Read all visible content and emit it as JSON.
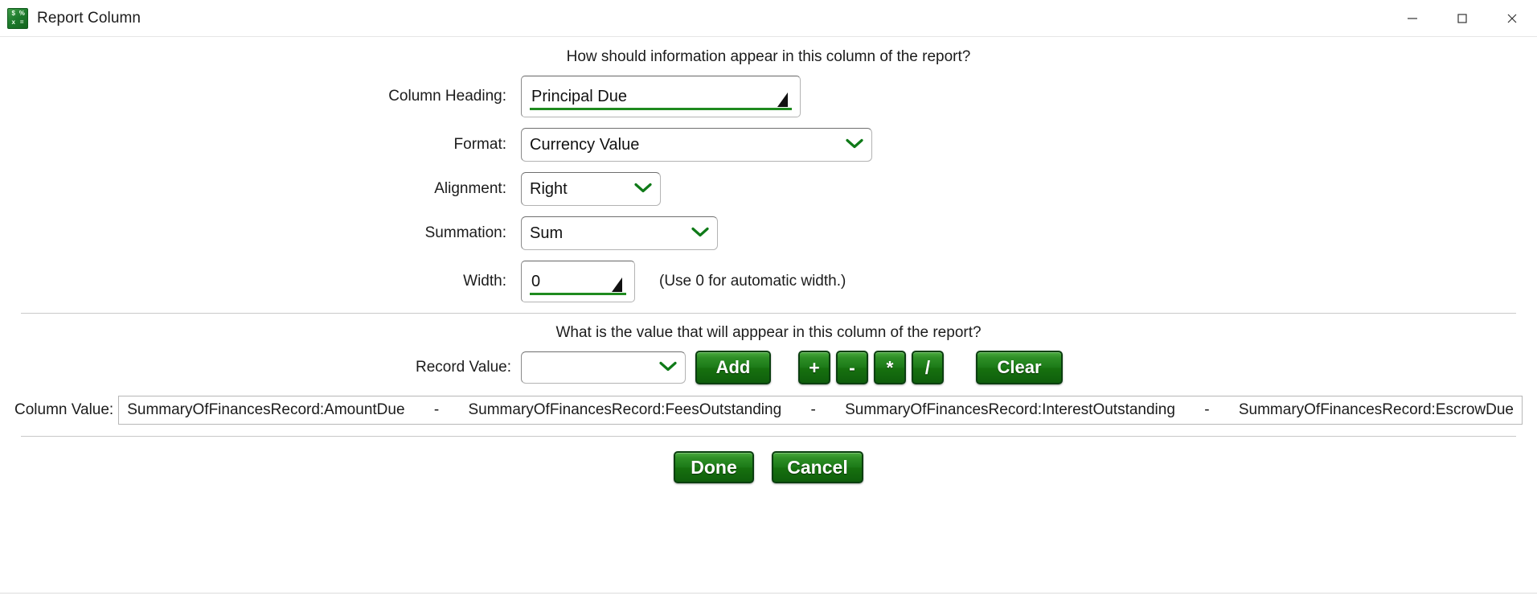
{
  "window": {
    "title": "Report Column",
    "icon": "calculator-icon",
    "icon_glyphs": [
      "$",
      "%",
      "x",
      "="
    ],
    "controls": {
      "minimize": "minimize-icon",
      "maximize": "maximize-icon",
      "close": "close-icon"
    }
  },
  "appearance": {
    "prompt": "How should information appear in this column of the report?",
    "fields": {
      "column_heading": {
        "label": "Column Heading:",
        "value": "Principal Due",
        "placeholder": ""
      },
      "format": {
        "label": "Format:",
        "value": "Currency Value",
        "options": [
          "Currency Value"
        ]
      },
      "alignment": {
        "label": "Alignment:",
        "value": "Right",
        "options": [
          "Right"
        ]
      },
      "summation": {
        "label": "Summation:",
        "value": "Sum",
        "options": [
          "Sum"
        ]
      },
      "width": {
        "label": "Width:",
        "value": "0",
        "hint": "(Use 0 for automatic width.)"
      }
    }
  },
  "value_section": {
    "prompt": "What is the value that will apppear in this column of the report?",
    "record_value": {
      "label": "Record Value:",
      "value": "",
      "placeholder": "",
      "options": []
    },
    "buttons": {
      "add": "Add",
      "plus": "+",
      "minus": "-",
      "multiply": "*",
      "divide": "/",
      "clear": "Clear"
    },
    "column_value": {
      "label": "Column Value:",
      "tokens": [
        {
          "type": "operand",
          "text": "SummaryOfFinancesRecord:AmountDue"
        },
        {
          "type": "operator",
          "text": "-"
        },
        {
          "type": "operand",
          "text": "SummaryOfFinancesRecord:FeesOutstanding"
        },
        {
          "type": "operator",
          "text": "-"
        },
        {
          "type": "operand",
          "text": "SummaryOfFinancesRecord:InterestOutstanding"
        },
        {
          "type": "operator",
          "text": "-"
        },
        {
          "type": "operand",
          "text": "SummaryOfFinancesRecord:EscrowDue"
        }
      ]
    }
  },
  "footer": {
    "done": "Done",
    "cancel": "Cancel"
  },
  "colors": {
    "accent_green": "#1e8a1e",
    "button_green_top": "#4aab3e",
    "button_green_bottom": "#0f5e0c",
    "button_border": "#0b3f10",
    "icon_green": "#1d7a2c",
    "field_border": "#b3b3b3",
    "text": "#1c1c1c"
  }
}
